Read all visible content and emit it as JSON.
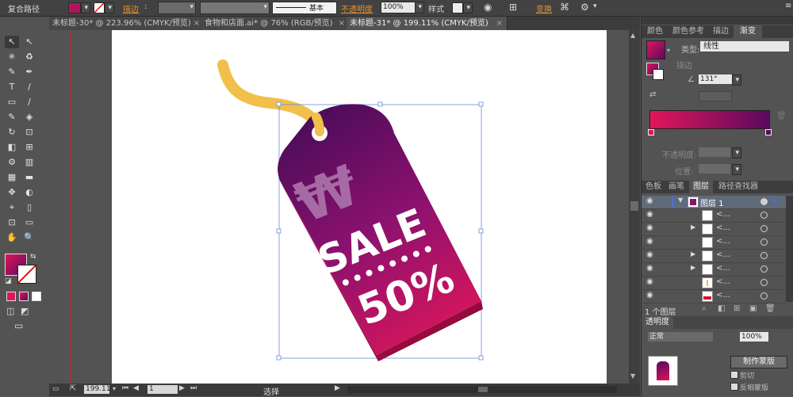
{
  "control_bar": {
    "object_type": "复合路径",
    "stroke_label": "描边",
    "stroke_style": "基本",
    "opacity_label": "不透明度",
    "opacity_value": "100%",
    "style_label": "样式",
    "transform_label": "变换"
  },
  "tabs": [
    {
      "label": "未标题-30* @ 223.96% (CMYK/预览)",
      "close": "×"
    },
    {
      "label": "食物和店面.ai* @ 76% (RGB/预览)",
      "close": "×"
    },
    {
      "label": "未标题-31* @ 199.11% (CMYK/预览)",
      "close": "×"
    }
  ],
  "tools": [
    [
      "↖",
      "↖"
    ],
    [
      "✳",
      "♻"
    ],
    [
      "✎",
      "✒"
    ],
    [
      "T",
      "/"
    ],
    [
      "▭",
      "/"
    ],
    [
      "✎",
      "◈"
    ],
    [
      "↻",
      "⊡"
    ],
    [
      "◧",
      "⊞"
    ],
    [
      "⚙",
      "▥"
    ],
    [
      "▦",
      "▬"
    ],
    [
      "✥",
      "◐"
    ],
    [
      "⌖",
      "▯"
    ],
    [
      "⊡",
      "▭"
    ],
    [
      "✋",
      "🔍"
    ]
  ],
  "colors": {
    "fill_start": "#e0165a",
    "fill_end": "#5a0a5e",
    "tag_dark": "#4a0c58",
    "tag_mid": "#8a1170",
    "tag_bottom": "#d8165a",
    "string": "#f0c04a"
  },
  "tag": {
    "currency_symbol": "₩",
    "line1": "SALE",
    "line2": "50%"
  },
  "status": {
    "zoom": "199.11",
    "page": "1",
    "tool": "选择"
  },
  "gradient_panel": {
    "tabs": [
      "颜色",
      "颜色参考",
      "描边",
      "渐变"
    ],
    "type_label": "类型:",
    "type_value": "线性",
    "stroke_label": "描边",
    "angle_value": "131°",
    "opacity_label": "不透明度:",
    "position_label": "位置:"
  },
  "layers_panel": {
    "tabs": [
      "色板",
      "画笔",
      "图层",
      "路径查找器"
    ],
    "layer_name": "图层 1",
    "sublayer_label": "<...",
    "footer": "1 个图层"
  },
  "transparency_panel": {
    "title": "透明度",
    "mode_short": "正常",
    "opacity_value": "100%",
    "make_mask": "制作蒙版",
    "clip_label": "剪切",
    "invert_label": "反相蒙版"
  }
}
